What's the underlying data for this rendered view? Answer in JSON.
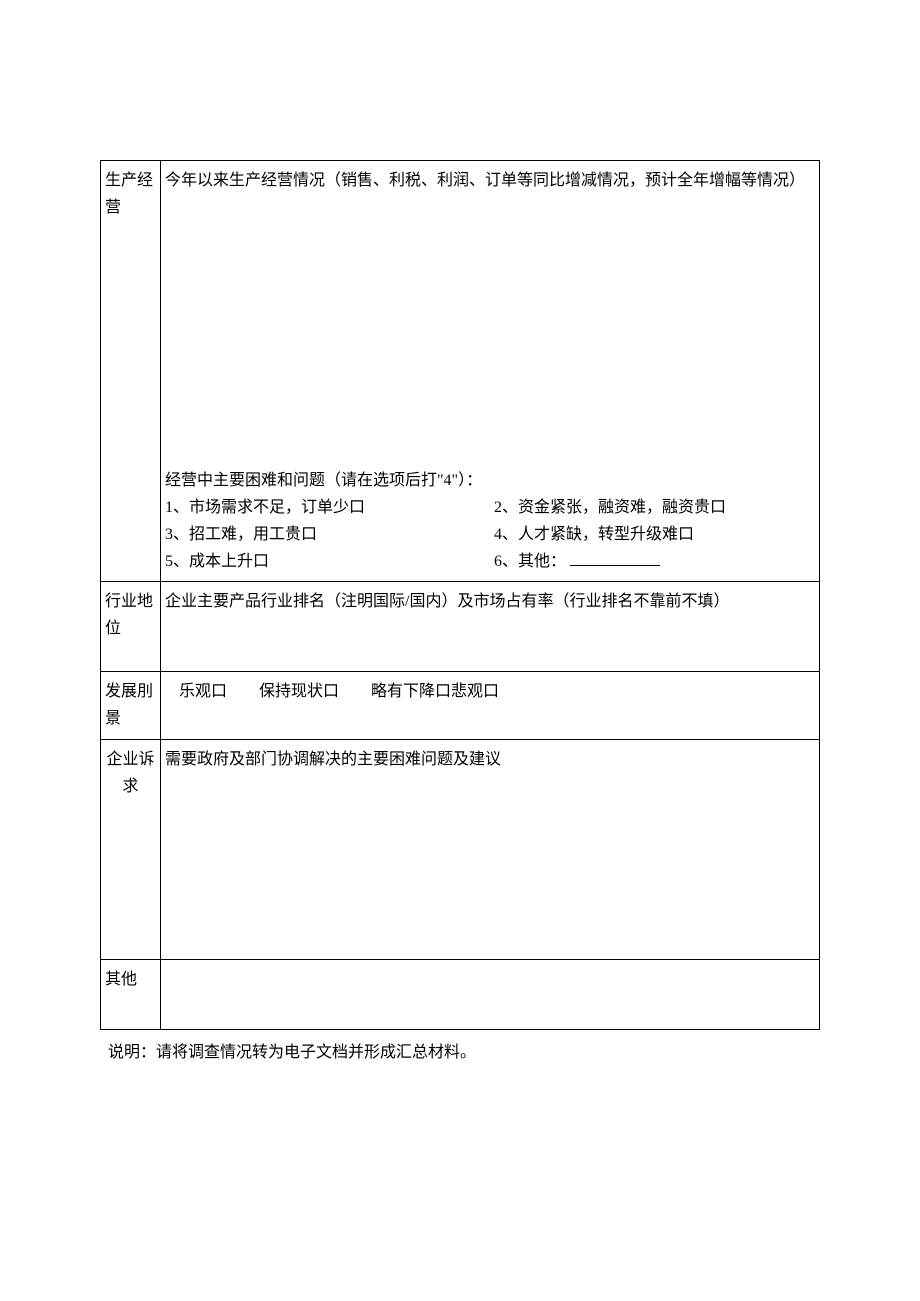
{
  "rows": {
    "production": {
      "label": "生产经营",
      "desc": "今年以来生产经营情况（销售、利税、利润、订单等同比增减情况，预计全年增幅等情况）",
      "issues_title": "经营中主要困难和问题（请在选项后打\"4\"）：",
      "issues": {
        "i1": "1、市场需求不足，订单少口",
        "i2": "2、资金紧张，融资难，融资贵口",
        "i3": "3、招工难，用工贵口",
        "i4": "4、人才紧缺，转型升级难口",
        "i5": "5、成本上升口",
        "i6": "6、其他："
      }
    },
    "industry": {
      "label": "行业地位",
      "desc": "企业主要产品行业排名（注明国际/国内）及市场占有率（行业排名不靠前不填）"
    },
    "prospect": {
      "label": "发展刖景",
      "options": {
        "o1": "乐观口",
        "o2": "保持现状口",
        "o3": "略有下降口悲观口"
      }
    },
    "appeal": {
      "label": "企业诉求",
      "desc": "需要政府及部门协调解决的主要困难问题及建议"
    },
    "other": {
      "label": "其他"
    }
  },
  "footnote": "说明：请将调查情况转为电子文档并形成汇总材料。"
}
